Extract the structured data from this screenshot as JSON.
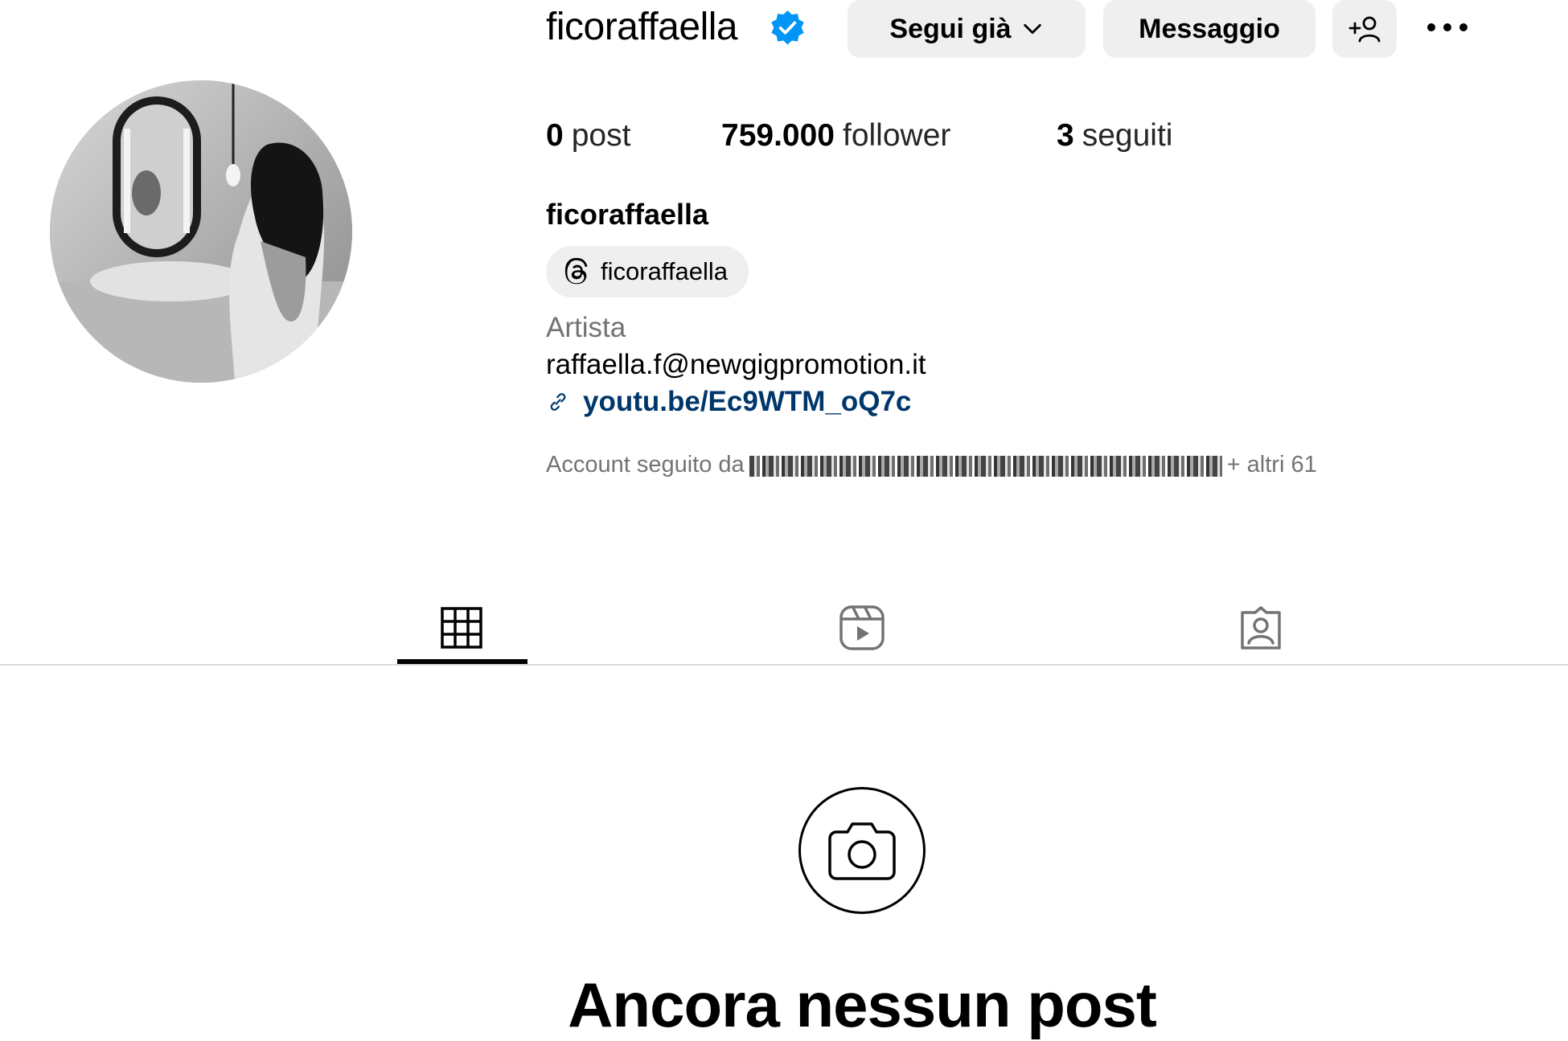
{
  "profile": {
    "username": "ficoraffaella",
    "verified_icon": "verified-badge-icon",
    "accent_color": "#0095f6"
  },
  "actions": {
    "follow_label": "Segui già",
    "message_label": "Messaggio",
    "add_user_icon": "add-user-icon",
    "more_icon": "more-options-icon"
  },
  "stats": {
    "posts_count": "0",
    "posts_label": "post",
    "followers_count": "759.000",
    "followers_label": "follower",
    "following_count": "3",
    "following_label": "seguiti"
  },
  "bio": {
    "full_name": "ficoraffaella",
    "threads_handle": "ficoraffaella",
    "category": "Artista",
    "email": "raffaella.f@newgigpromotion.it",
    "link": "youtu.be/Ec9WTM_oQ7c",
    "link_color": "#00376b",
    "followed_by_prefix": "Account seguito da",
    "followed_by_suffix": "+ altri 61"
  },
  "tabs": [
    {
      "icon": "grid-icon",
      "active": true
    },
    {
      "icon": "reels-icon",
      "active": false
    },
    {
      "icon": "tagged-icon",
      "active": false
    }
  ],
  "empty_state": {
    "icon": "camera-icon",
    "title": "Ancora nessun post"
  }
}
